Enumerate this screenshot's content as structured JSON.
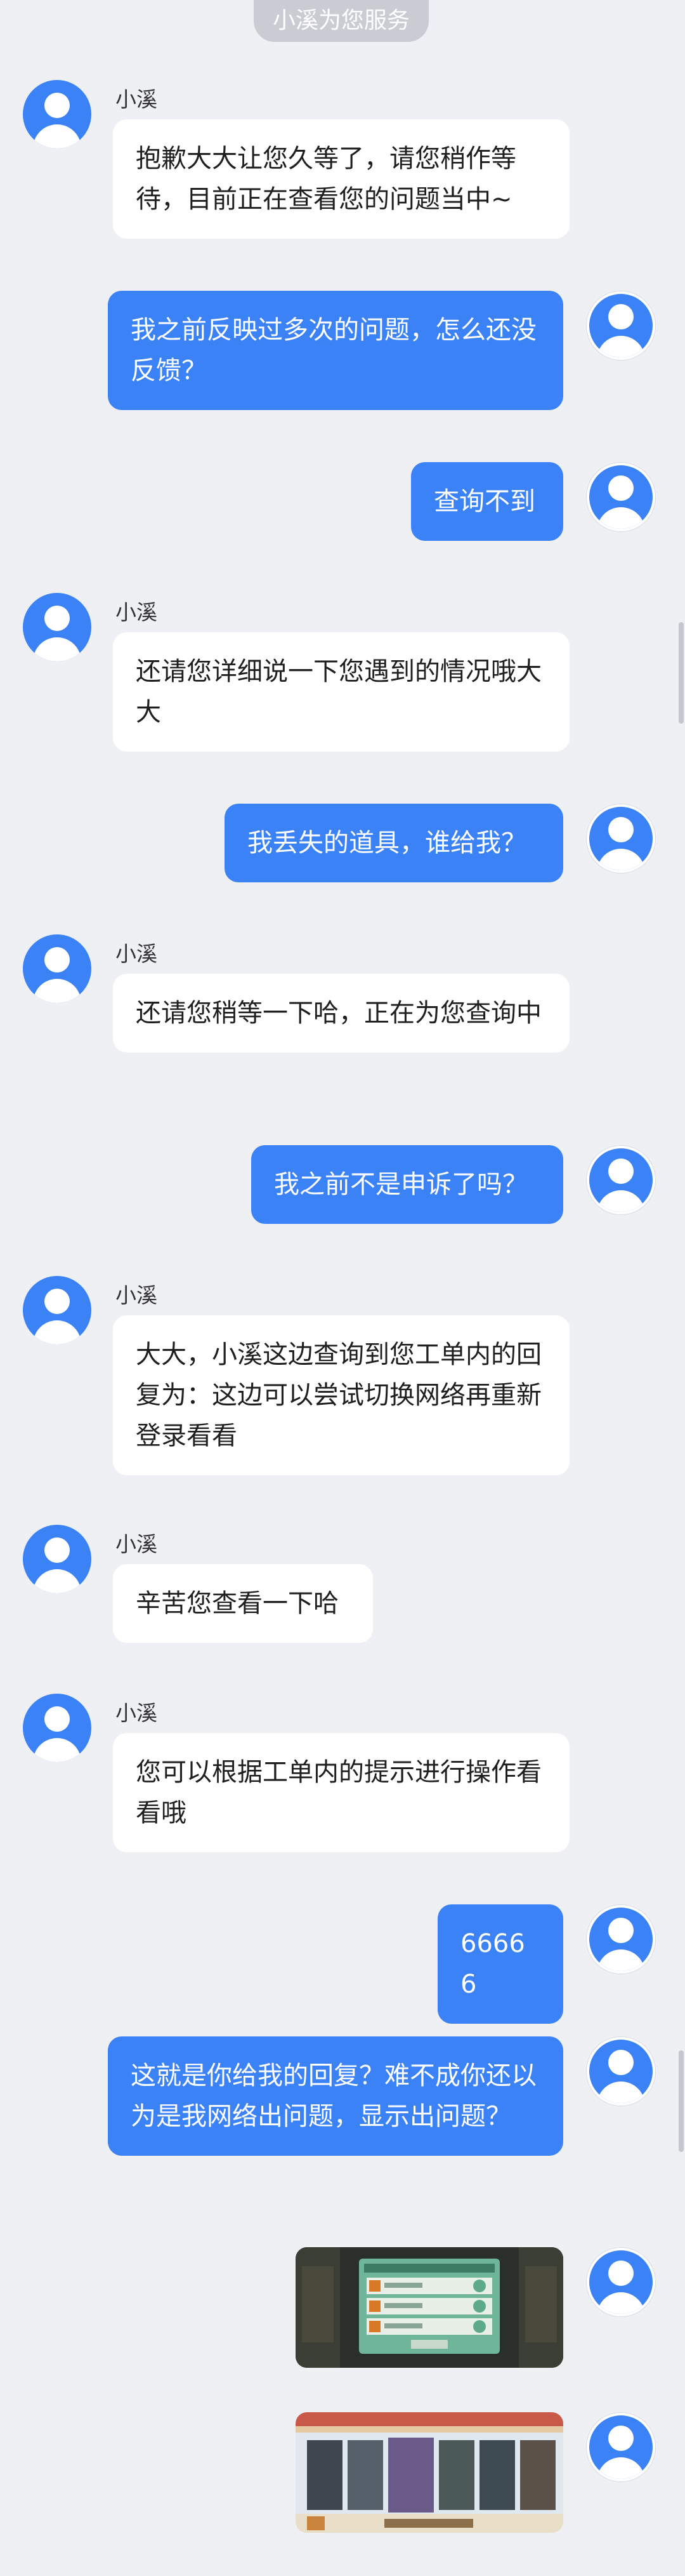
{
  "header": {
    "service_label": "小溪为您服务"
  },
  "agent": {
    "name": "小溪"
  },
  "messages": [
    {
      "side": "left",
      "text": "抱歉大大让您久等了，请您稍作等待，目前正在查看您的问题当中~"
    },
    {
      "side": "right",
      "text": "我之前反映过多次的问题，怎么还没反馈？"
    },
    {
      "side": "right",
      "text": "查询不到"
    },
    {
      "side": "left",
      "text": "还请您详细说一下您遇到的情况哦大大"
    },
    {
      "side": "right",
      "text": "我丢失的道具，谁给我？"
    },
    {
      "side": "left",
      "text": "还请您稍等一下哈，正在为您查询中"
    },
    {
      "side": "right",
      "text": "我之前不是申诉了吗？"
    },
    {
      "side": "left",
      "text": "大大，小溪这边查询到您工单内的回复为：这边可以尝试切换网络再重新登录看看"
    },
    {
      "side": "left",
      "text": "辛苦您查看一下哈"
    },
    {
      "side": "left",
      "text": "您可以根据工单内的提示进行操作看看哦"
    },
    {
      "side": "right",
      "text": "66666"
    },
    {
      "side": "right",
      "text": "这就是你给我的回复？难不成你还以为是我网络出问题，显示出问题？"
    },
    {
      "side": "right",
      "type": "image",
      "alt": "game-screenshot"
    },
    {
      "side": "right",
      "type": "image",
      "alt": "game-screenshot"
    }
  ],
  "colors": {
    "background": "#eef0f4",
    "bubble_right": "#3a82f6",
    "bubble_left": "#ffffff",
    "avatar": "#3a82f6",
    "system_pill": "#c9ccd3"
  }
}
